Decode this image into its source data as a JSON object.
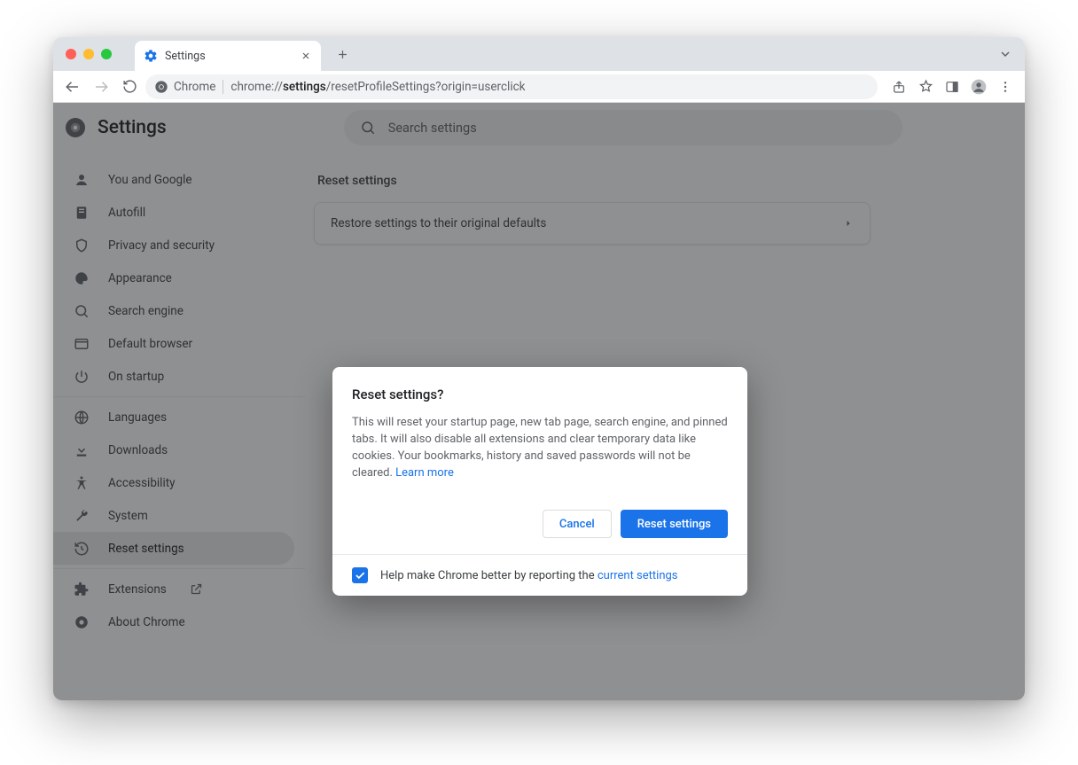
{
  "browser": {
    "tab": {
      "title": "Settings"
    },
    "address": {
      "scheme_label": "Chrome",
      "url_prefix": "chrome://",
      "url_bold": "settings",
      "url_rest": "/resetProfileSettings?origin=userclick"
    }
  },
  "settings": {
    "title": "Settings",
    "search_placeholder": "Search settings",
    "sidebar": {
      "g1": [
        {
          "label": "You and Google"
        },
        {
          "label": "Autofill"
        },
        {
          "label": "Privacy and security"
        },
        {
          "label": "Appearance"
        },
        {
          "label": "Search engine"
        },
        {
          "label": "Default browser"
        },
        {
          "label": "On startup"
        }
      ],
      "g2": [
        {
          "label": "Languages"
        },
        {
          "label": "Downloads"
        },
        {
          "label": "Accessibility"
        },
        {
          "label": "System"
        },
        {
          "label": "Reset settings"
        }
      ],
      "g3": [
        {
          "label": "Extensions"
        },
        {
          "label": "About Chrome"
        }
      ]
    },
    "main": {
      "section_title": "Reset settings",
      "card_text": "Restore settings to their original defaults"
    }
  },
  "dialog": {
    "title": "Reset settings?",
    "body": "This will reset your startup page, new tab page, search engine, and pinned tabs. It will also disable all extensions and clear temporary data like cookies. Your bookmarks, history and saved passwords will not be cleared. ",
    "learn_more": "Learn more",
    "cancel": "Cancel",
    "confirm": "Reset settings",
    "footer_prefix": "Help make Chrome better by reporting the ",
    "footer_link": "current settings",
    "checked": true
  }
}
